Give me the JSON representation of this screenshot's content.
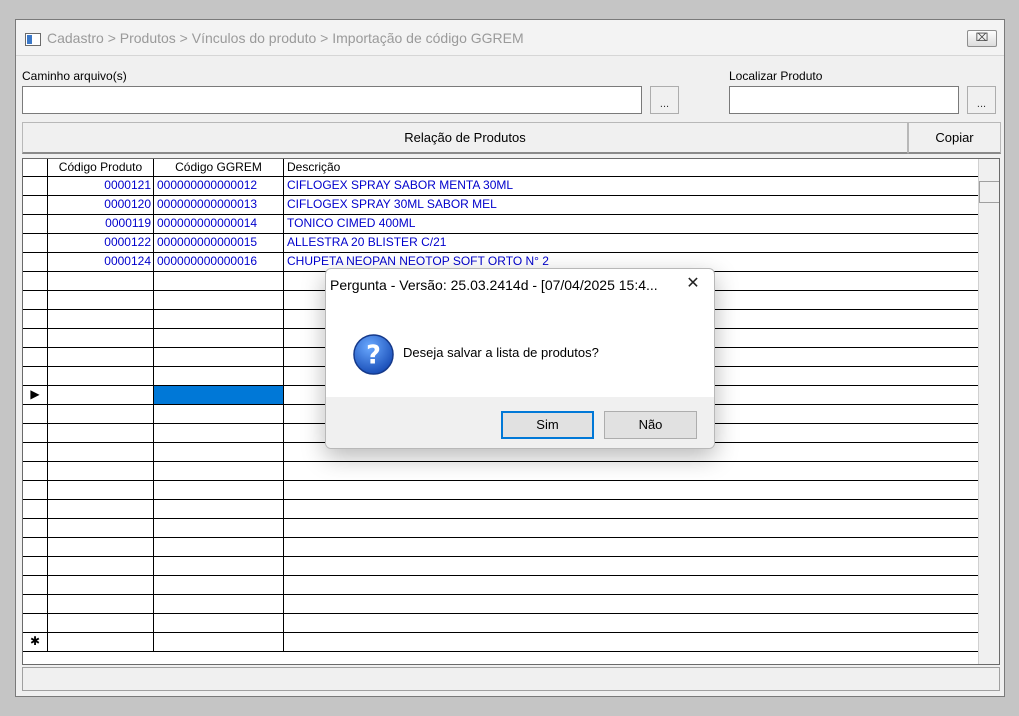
{
  "window": {
    "breadcrumb": "Cadastro > Produtos > Vínculos do produto > Importação de código GGREM",
    "close_glyph": "⌧"
  },
  "form": {
    "path_label": "Caminho arquivo(s)",
    "path_value": "",
    "path_browse": "...",
    "locate_label": "Localizar Produto",
    "locate_value": "",
    "locate_browse": "..."
  },
  "toolbar": {
    "relation_label": "Relação de Produtos",
    "copy_label": "Copiar"
  },
  "grid": {
    "headers": [
      "Código Produto",
      "Código GGREM",
      "Descrição"
    ],
    "rows": [
      {
        "code": "0000121",
        "ggrem": "000000000000012",
        "desc": "CIFLOGEX SPRAY SABOR MENTA 30ML"
      },
      {
        "code": "0000120",
        "ggrem": "000000000000013",
        "desc": "CIFLOGEX SPRAY 30ML SABOR MEL"
      },
      {
        "code": "0000119",
        "ggrem": "000000000000014",
        "desc": "TONICO CIMED 400ML"
      },
      {
        "code": "0000122",
        "ggrem": "000000000000015",
        "desc": "ALLESTRA 20 BLISTER C/21"
      },
      {
        "code": "0000124",
        "ggrem": "000000000000016",
        "desc": "CHUPETA NEOPAN NEOTOP SOFT ORTO N° 2"
      }
    ],
    "current_row_marker": "▶",
    "new_row_marker": "✱",
    "selected_color": "#0078d7"
  },
  "dialog": {
    "title": "Pergunta - Versão: 25.03.2414d - [07/04/2025 15:4...",
    "close_glyph": "✕",
    "icon": "question-icon",
    "message": "Deseja salvar a lista de produtos?",
    "yes_label": "Sim",
    "no_label": "Não"
  }
}
